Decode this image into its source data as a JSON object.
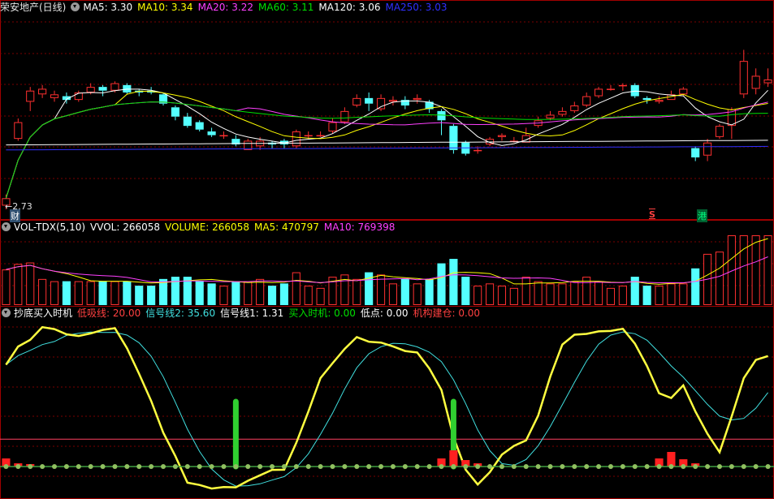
{
  "header_main": {
    "stock_name": "荣安地产(日线)",
    "ma": [
      {
        "label": "MA5: 3.30",
        "color": "#ffffff"
      },
      {
        "label": "MA10: 3.34",
        "color": "#ffff00"
      },
      {
        "label": "MA20: 3.22",
        "color": "#ff40ff"
      },
      {
        "label": "MA60: 3.11",
        "color": "#00e000"
      },
      {
        "label": "MA120: 3.06",
        "color": "#ffffff"
      },
      {
        "label": "MA250: 3.03",
        "color": "#3030ff"
      }
    ]
  },
  "header_vol": {
    "items": [
      {
        "label": "VOL-TDX(5,10)",
        "color": "#ffffff"
      },
      {
        "label": "VVOL: 266058",
        "color": "#ffffff"
      },
      {
        "label": "VOLUME: 266058",
        "color": "#ffff00"
      },
      {
        "label": "MA5: 470797",
        "color": "#ffff00"
      },
      {
        "label": "MA10: 769398",
        "color": "#ff40ff"
      }
    ]
  },
  "header_ind": {
    "items": [
      {
        "label": "抄底买入时机",
        "color": "#ffffff"
      },
      {
        "label": "低吸线: 20.00",
        "color": "#ff4040"
      },
      {
        "label": "信号线2: 35.60",
        "color": "#40e0e0"
      },
      {
        "label": "信号线1: 1.31",
        "color": "#ffffff"
      },
      {
        "label": "买入时机: 0.00",
        "color": "#00e000"
      },
      {
        "label": "低点: 0.00",
        "color": "#ffffff"
      },
      {
        "label": "机构建仓: 0.00",
        "color": "#ff4040"
      }
    ]
  },
  "markers": {
    "low_price": "←2.73",
    "cai": "财",
    "s": "S",
    "gang": "港"
  },
  "colors": {
    "up": "#ff3030",
    "down": "#54ffff",
    "grid": "#7a0000",
    "border": "#a00000"
  },
  "chart_data": {
    "type": "candlestick",
    "bar_count": 64,
    "price_range": [
      2.7,
      3.75
    ],
    "candles": [
      {
        "o": 2.72,
        "c": 2.76,
        "h": 2.78,
        "l": 2.7
      },
      {
        "o": 3.08,
        "c": 3.17,
        "h": 3.19,
        "l": 3.07
      },
      {
        "o": 3.28,
        "c": 3.34,
        "h": 3.36,
        "l": 3.23
      },
      {
        "o": 3.32,
        "c": 3.35,
        "h": 3.37,
        "l": 3.3
      },
      {
        "o": 3.3,
        "c": 3.32,
        "h": 3.34,
        "l": 3.28
      },
      {
        "o": 3.31,
        "c": 3.29,
        "h": 3.33,
        "l": 3.27
      },
      {
        "o": 3.29,
        "c": 3.33,
        "h": 3.34,
        "l": 3.28
      },
      {
        "o": 3.33,
        "c": 3.36,
        "h": 3.38,
        "l": 3.32
      },
      {
        "o": 3.36,
        "c": 3.34,
        "h": 3.37,
        "l": 3.31
      },
      {
        "o": 3.34,
        "c": 3.38,
        "h": 3.39,
        "l": 3.33
      },
      {
        "o": 3.37,
        "c": 3.33,
        "h": 3.38,
        "l": 3.32
      },
      {
        "o": 3.34,
        "c": 3.33,
        "h": 3.35,
        "l": 3.31
      },
      {
        "o": 3.34,
        "c": 3.33,
        "h": 3.36,
        "l": 3.32
      },
      {
        "o": 3.32,
        "c": 3.27,
        "h": 3.33,
        "l": 3.26
      },
      {
        "o": 3.25,
        "c": 3.2,
        "h": 3.26,
        "l": 3.18
      },
      {
        "o": 3.2,
        "c": 3.15,
        "h": 3.22,
        "l": 3.14
      },
      {
        "o": 3.17,
        "c": 3.13,
        "h": 3.18,
        "l": 3.12
      },
      {
        "o": 3.12,
        "c": 3.1,
        "h": 3.14,
        "l": 3.09
      },
      {
        "o": 3.1,
        "c": 3.1,
        "h": 3.12,
        "l": 3.08
      },
      {
        "o": 3.08,
        "c": 3.05,
        "h": 3.1,
        "l": 3.04
      },
      {
        "o": 3.02,
        "c": 3.07,
        "h": 3.08,
        "l": 3.02
      },
      {
        "o": 3.04,
        "c": 3.07,
        "h": 3.09,
        "l": 3.02
      },
      {
        "o": 3.06,
        "c": 3.05,
        "h": 3.07,
        "l": 3.03
      },
      {
        "o": 3.07,
        "c": 3.05,
        "h": 3.08,
        "l": 3.03
      },
      {
        "o": 3.04,
        "c": 3.12,
        "h": 3.13,
        "l": 3.03
      },
      {
        "o": 3.1,
        "c": 3.1,
        "h": 3.12,
        "l": 3.08
      },
      {
        "o": 3.1,
        "c": 3.1,
        "h": 3.12,
        "l": 3.09
      },
      {
        "o": 3.12,
        "c": 3.17,
        "h": 3.19,
        "l": 3.11
      },
      {
        "o": 3.17,
        "c": 3.23,
        "h": 3.25,
        "l": 3.16
      },
      {
        "o": 3.26,
        "c": 3.3,
        "h": 3.32,
        "l": 3.25
      },
      {
        "o": 3.3,
        "c": 3.27,
        "h": 3.33,
        "l": 3.23
      },
      {
        "o": 3.24,
        "c": 3.3,
        "h": 3.32,
        "l": 3.23
      },
      {
        "o": 3.28,
        "c": 3.29,
        "h": 3.31,
        "l": 3.26
      },
      {
        "o": 3.29,
        "c": 3.26,
        "h": 3.31,
        "l": 3.24
      },
      {
        "o": 3.29,
        "c": 3.3,
        "h": 3.32,
        "l": 3.27
      },
      {
        "o": 3.28,
        "c": 3.24,
        "h": 3.29,
        "l": 3.22
      },
      {
        "o": 3.23,
        "c": 3.18,
        "h": 3.24,
        "l": 3.1
      },
      {
        "o": 3.15,
        "c": 3.02,
        "h": 3.16,
        "l": 3.0
      },
      {
        "o": 3.06,
        "c": 3.0,
        "h": 3.07,
        "l": 2.99
      },
      {
        "o": 3.02,
        "c": 3.02,
        "h": 3.04,
        "l": 3.0
      },
      {
        "o": 3.05,
        "c": 3.08,
        "h": 3.09,
        "l": 3.04
      },
      {
        "o": 3.09,
        "c": 3.1,
        "h": 3.11,
        "l": 3.07
      },
      {
        "o": 3.07,
        "c": 3.07,
        "h": 3.09,
        "l": 3.06
      },
      {
        "o": 3.06,
        "c": 3.1,
        "h": 3.14,
        "l": 3.06
      },
      {
        "o": 3.15,
        "c": 3.18,
        "h": 3.2,
        "l": 3.14
      },
      {
        "o": 3.19,
        "c": 3.21,
        "h": 3.23,
        "l": 3.18
      },
      {
        "o": 3.21,
        "c": 3.23,
        "h": 3.25,
        "l": 3.2
      },
      {
        "o": 3.23,
        "c": 3.26,
        "h": 3.28,
        "l": 3.22
      },
      {
        "o": 3.26,
        "c": 3.31,
        "h": 3.33,
        "l": 3.25
      },
      {
        "o": 3.31,
        "c": 3.35,
        "h": 3.36,
        "l": 3.3
      },
      {
        "o": 3.35,
        "c": 3.35,
        "h": 3.37,
        "l": 3.34
      },
      {
        "o": 3.37,
        "c": 3.37,
        "h": 3.38,
        "l": 3.34
      },
      {
        "o": 3.37,
        "c": 3.31,
        "h": 3.38,
        "l": 3.3
      },
      {
        "o": 3.3,
        "c": 3.29,
        "h": 3.31,
        "l": 3.27
      },
      {
        "o": 3.28,
        "c": 3.29,
        "h": 3.31,
        "l": 3.27
      },
      {
        "o": 3.29,
        "c": 3.32,
        "h": 3.34,
        "l": 3.29
      },
      {
        "o": 3.32,
        "c": 3.35,
        "h": 3.36,
        "l": 3.31
      },
      {
        "o": 3.03,
        "c": 2.98,
        "h": 3.04,
        "l": 2.96
      },
      {
        "o": 2.99,
        "c": 3.06,
        "h": 3.08,
        "l": 2.96
      },
      {
        "o": 3.09,
        "c": 3.15,
        "h": 3.16,
        "l": 3.08
      },
      {
        "o": 3.15,
        "c": 3.24,
        "h": 3.25,
        "l": 3.08
      },
      {
        "o": 3.32,
        "c": 3.5,
        "h": 3.56,
        "l": 3.3
      },
      {
        "o": 3.35,
        "c": 3.42,
        "h": 3.46,
        "l": 3.32
      },
      {
        "o": 3.38,
        "c": 3.4,
        "h": 3.46,
        "l": 3.36
      }
    ]
  }
}
